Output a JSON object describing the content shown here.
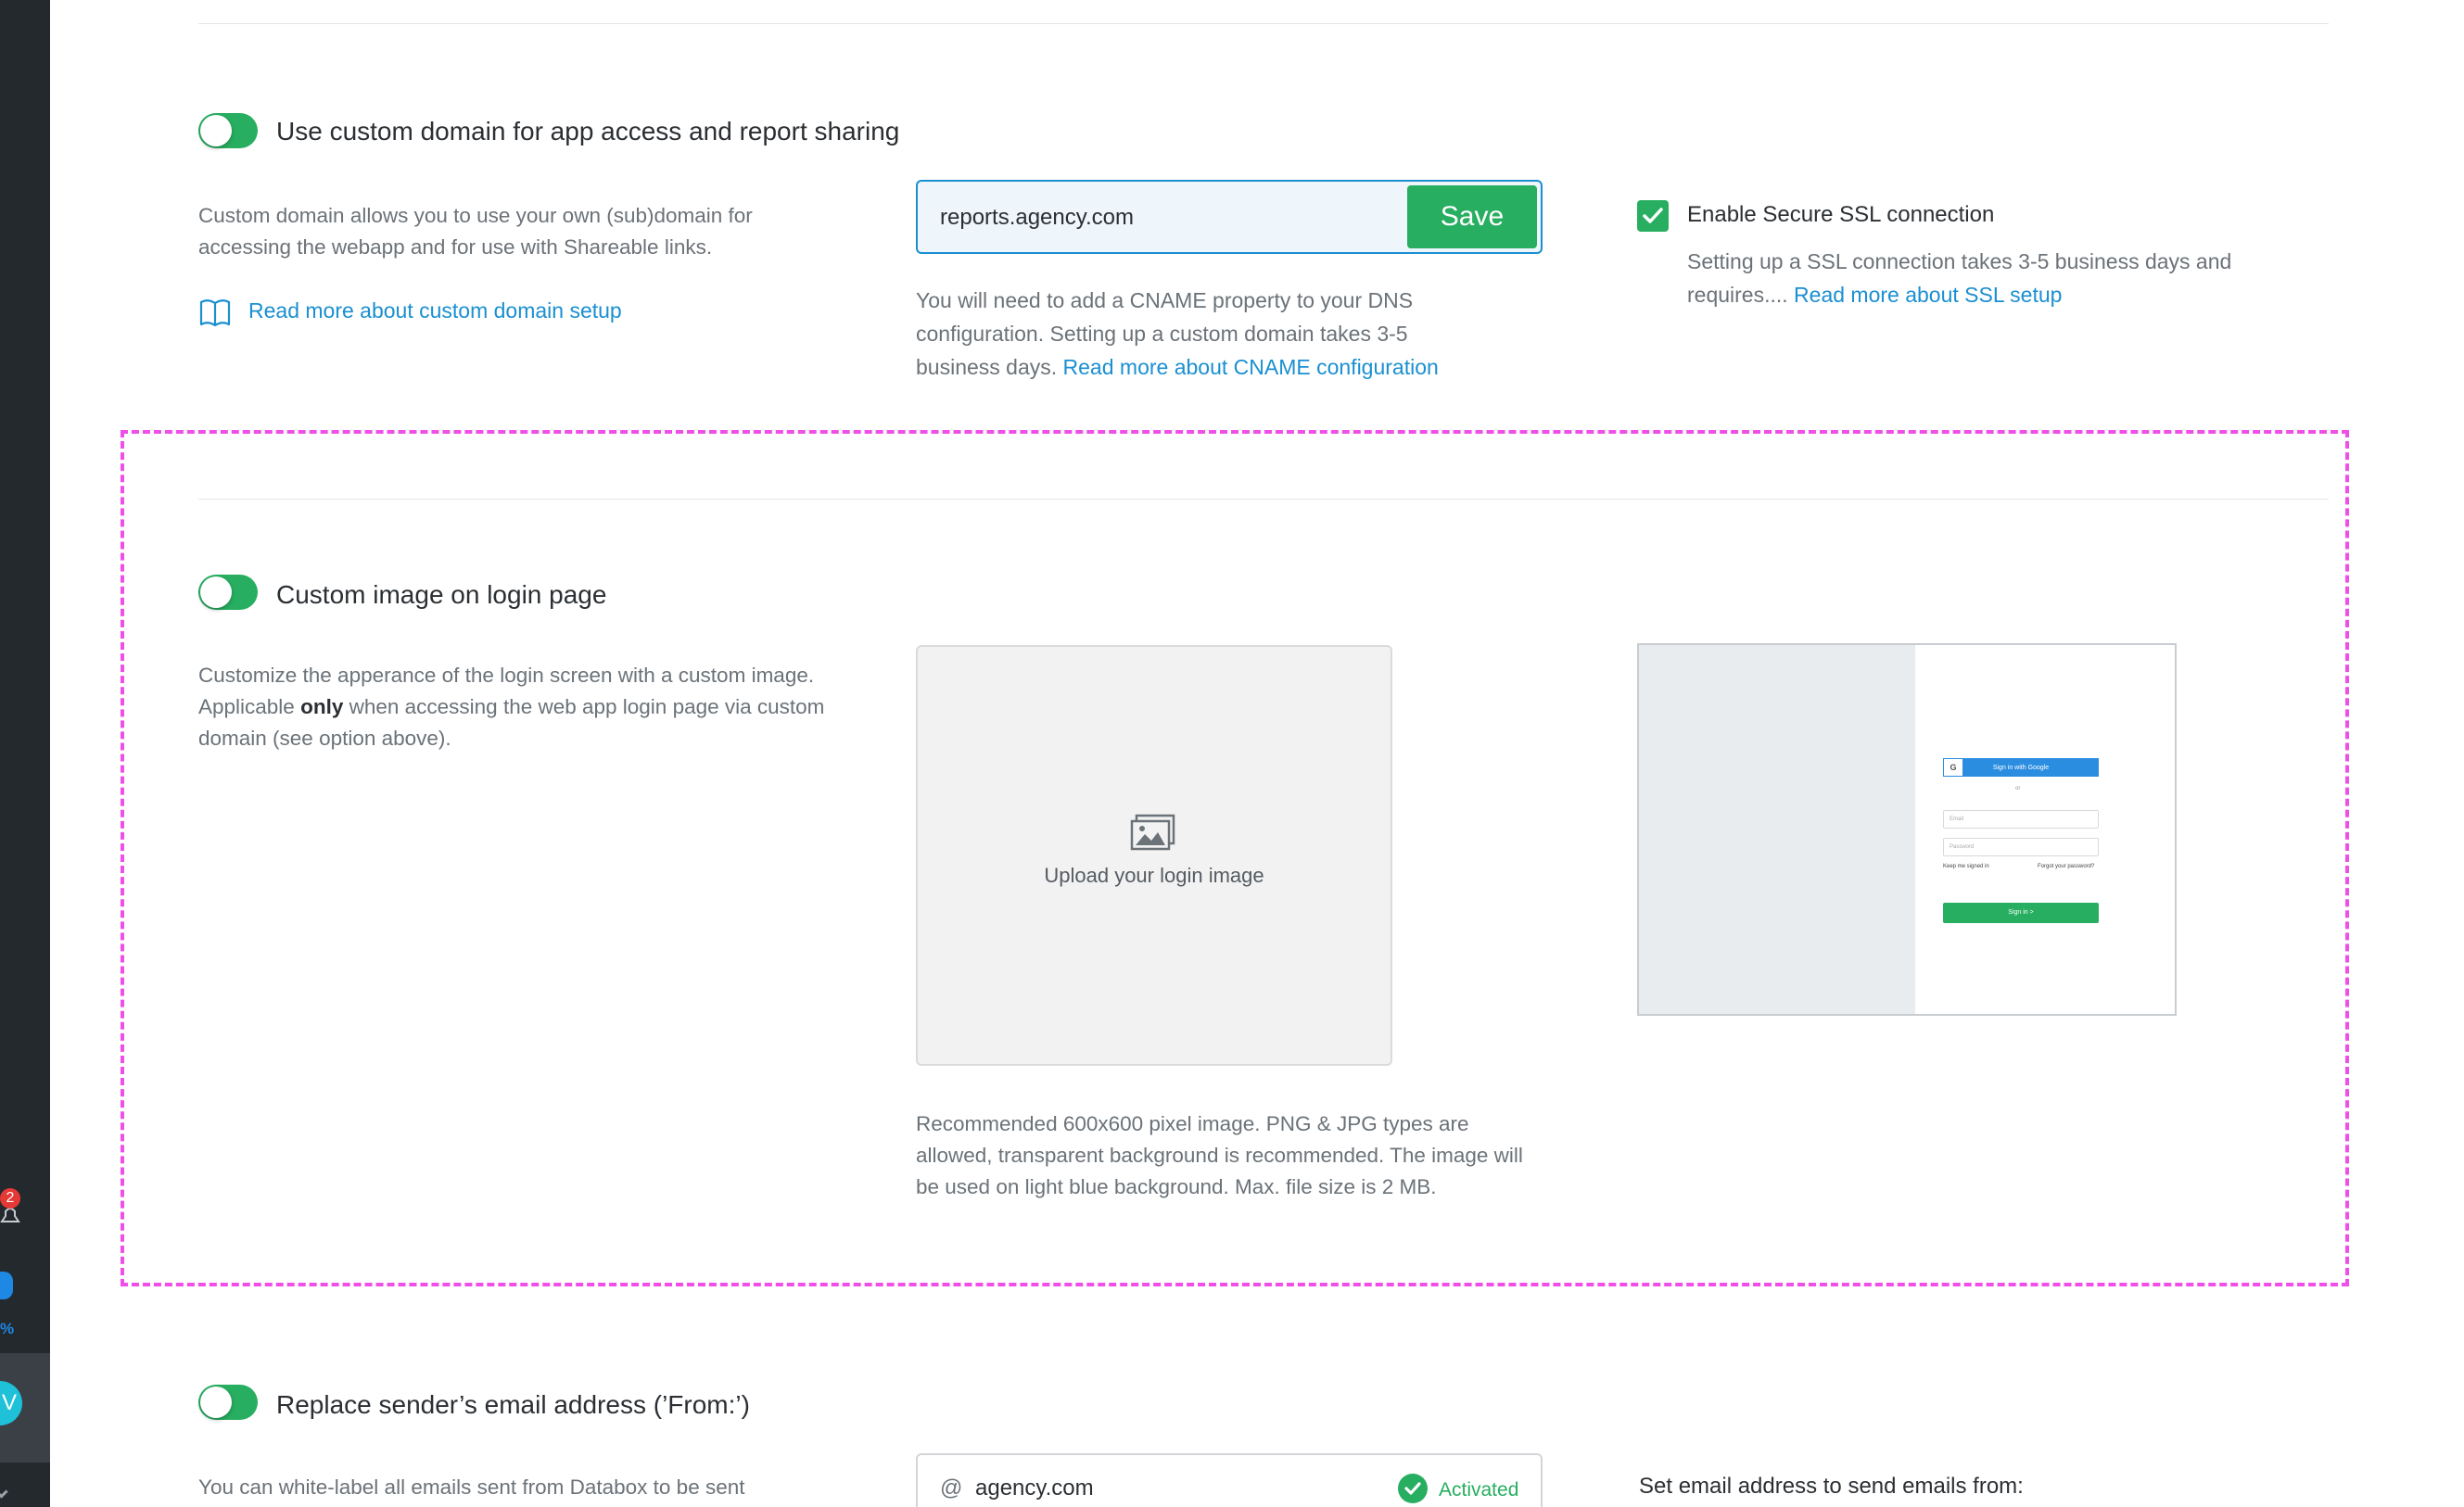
{
  "sidebar": {
    "notification_count": "2",
    "progress_suffix": "%",
    "avatar_initial": "V"
  },
  "custom_domain": {
    "toggle_on": true,
    "title": "Use custom domain for app access and report sharing",
    "description": "Custom domain allows you to use your own (sub)domain for accessing the webapp and for use with Shareable links.",
    "read_more_link": "Read more about custom domain setup",
    "domain_value": "reports.agency.com",
    "save_label": "Save",
    "help_text": "You will need to add a CNAME property to your DNS configuration. Setting up a custom domain takes 3-5 business days. ",
    "help_link": "Read more about CNAME configuration",
    "ssl_label": "Enable Secure SSL connection",
    "ssl_checked": true,
    "ssl_help": "Setting up a SSL connection takes 3-5 business days and requires.... ",
    "ssl_link": "Read more about SSL setup"
  },
  "login_image": {
    "toggle_on": true,
    "title": "Custom image on login page",
    "description_part1": "Customize the apperance of the login screen with a custom image. Applicable ",
    "description_bold": "only",
    "description_part2": " when accessing the web app login page via custom domain (see option above).",
    "upload_label": "Upload your login image",
    "help_text": "Recommended 600x600 pixel image. PNG & JPG types are allowed, transparent background is recommended. The image will be used on light blue background. Max. file size is 2 MB.",
    "preview": {
      "google_label": "Sign in with Google",
      "google_glyph": "G",
      "or_label": "or",
      "email_placeholder": "Email",
      "password_placeholder": "Password",
      "keep_signed_in": "Keep me signed in",
      "forgot_password": "Forgot your password?",
      "signin_label": "Sign in >"
    }
  },
  "sender_email": {
    "toggle_on": true,
    "title": "Replace sender’s email address (’From:’)",
    "description": "You can white-label all emails sent from Databox to be sent",
    "at_symbol": "@",
    "domain_value": "agency.com",
    "status_label": "Activated",
    "set_email_label": "Set email address to send emails from:"
  },
  "colors": {
    "accent_green": "#27ae60",
    "link_blue": "#1a8fd1",
    "highlight_frame": "#f04ee8"
  },
  "icons": [
    "bell-icon",
    "award-icon",
    "book-icon",
    "checkmark-icon",
    "image-upload-icon",
    "activated-check-icon"
  ]
}
